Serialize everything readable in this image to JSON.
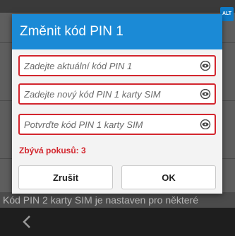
{
  "dialog": {
    "title": "Změnit kód PIN 1",
    "fields": [
      {
        "placeholder": "Zadejte aktuální kód PIN 1"
      },
      {
        "placeholder": "Zadejte nový kód PIN 1 karty SIM"
      },
      {
        "placeholder": "Potvrďte kód PIN 1 karty SIM"
      }
    ],
    "attempts_text": "Zbývá pokusů: 3",
    "cancel_label": "Zrušit",
    "ok_label": "OK"
  },
  "background": {
    "text": "Kód PIN 2 karty SIM je nastaven pro některé"
  },
  "keyboard_badge": "ALT",
  "icons": {
    "reveal": "eye-icon",
    "back": "back-icon"
  },
  "colors": {
    "header": "#1b8ad6",
    "error": "#d3262e",
    "badge": "#0e7ac6"
  }
}
